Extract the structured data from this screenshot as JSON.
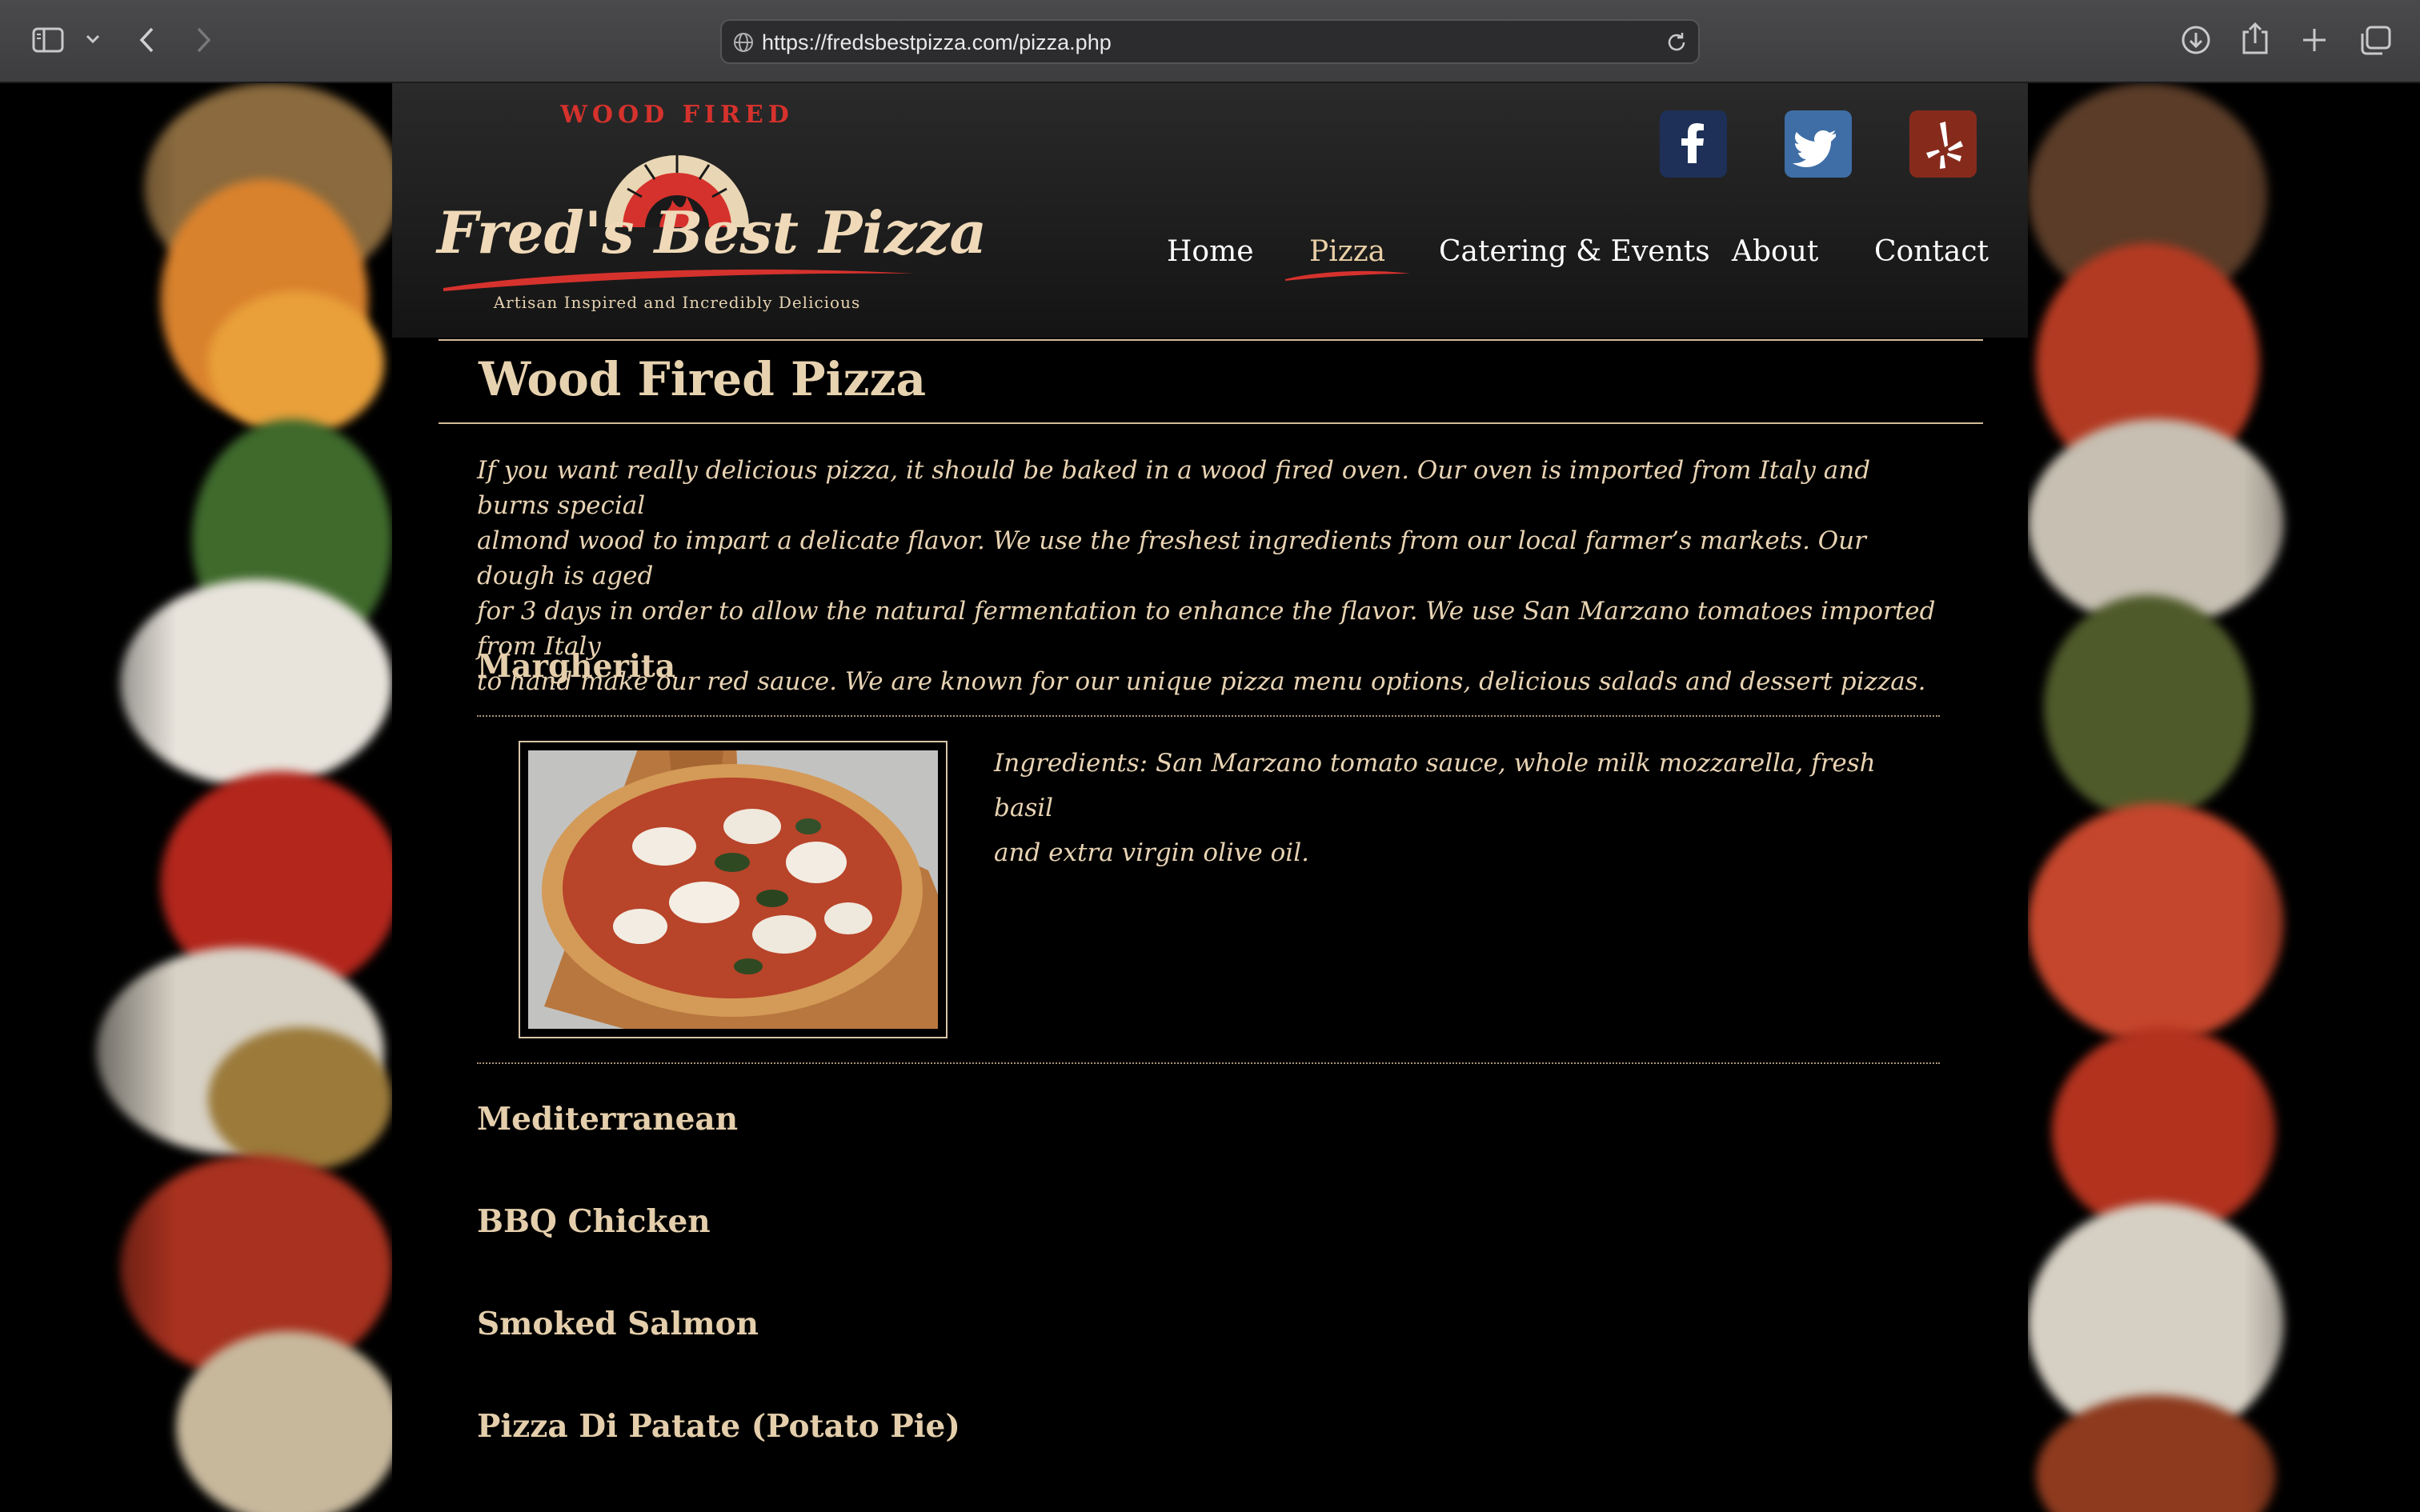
{
  "browser": {
    "url": "https://fredsbestpizza.com/pizza.php"
  },
  "site": {
    "logo_top": "WOOD FIRED",
    "logo_name": "Fred's Best Pizza",
    "logo_tagline": "Artisan Inspired and Incredibly Delicious",
    "social": [
      {
        "name": "facebook",
        "icon": "facebook-icon",
        "color": "#1e3058"
      },
      {
        "name": "twitter",
        "icon": "twitter-icon",
        "color": "#3f6ea6"
      },
      {
        "name": "yelp",
        "icon": "yelp-icon",
        "color": "#862b1c"
      }
    ],
    "nav": {
      "home": "Home",
      "pizza": "Pizza",
      "catering": "Catering & Events",
      "about": "About",
      "contact": "Contact",
      "active": "Pizza"
    }
  },
  "main": {
    "title": "Wood Fired Pizza",
    "intro_lines": [
      "If you want really delicious pizza, it should be baked in a wood fired oven. Our oven is imported from Italy and burns special",
      "almond wood to impart a delicate flavor. We use the freshest ingredients from our local farmer’s markets. Our dough is aged",
      "for 3 days in order to allow the natural fermentation to enhance the flavor. We use San Marzano tomatoes imported from Italy",
      "to hand make our red sauce. We are known for our unique pizza menu options, delicious salads and dessert pizzas."
    ],
    "menu": [
      {
        "name": "Margherita",
        "expanded": true,
        "ingredient_lines": [
          "Ingredients: San Marzano tomato sauce, whole milk mozzarella, fresh basil",
          "and extra virgin olive oil."
        ]
      },
      {
        "name": "Mediterranean"
      },
      {
        "name": "BBQ Chicken"
      },
      {
        "name": "Smoked Salmon"
      },
      {
        "name": "Pizza Di Patate (Potato Pie)"
      }
    ]
  },
  "colors": {
    "accent_red": "#d6322d",
    "text_cream": "#e8d3b3",
    "background": "#000000"
  }
}
